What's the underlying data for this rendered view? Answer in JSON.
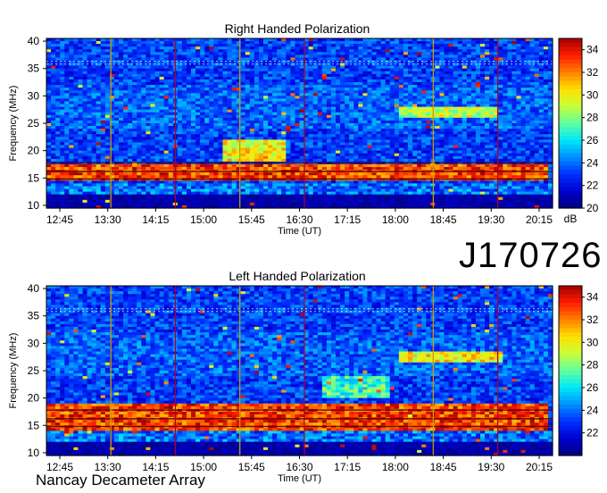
{
  "figure": {
    "id_label": "J170726",
    "footer": "Nancay Decameter Array"
  },
  "colors": {
    "colormap": [
      "#00007f",
      "#0000d0",
      "#0030ff",
      "#0090ff",
      "#00e8f8",
      "#60ffa0",
      "#c8ff38",
      "#ffe000",
      "#ff8000",
      "#ff1c00",
      "#a00000"
    ],
    "marker_lines": [
      "#c89a00",
      "#b00020",
      "#c89a00",
      "#b00020"
    ]
  },
  "chart_data": [
    {
      "type": "heatmap",
      "title": "Right Handed Polarization",
      "xlabel": "Time (UT)",
      "ylabel": "Frequency (MHz)",
      "x_ticks": [
        "12:45",
        "13:30",
        "14:15",
        "15:00",
        "15:45",
        "16:30",
        "17:15",
        "18:00",
        "18:45",
        "19:30",
        "20:15"
      ],
      "x_range_hours": [
        12.5,
        20.35
      ],
      "y_ticks": [
        10,
        15,
        20,
        25,
        30,
        35,
        40
      ],
      "ylim": [
        9.5,
        40.5
      ],
      "colorbar": {
        "label": "dB",
        "range": [
          20,
          35
        ],
        "ticks": [
          20,
          22,
          24,
          26,
          28,
          30,
          32,
          34
        ]
      },
      "vertical_markers_ut": [
        13.5,
        14.5,
        15.5,
        16.5,
        18.5,
        19.5
      ],
      "bright_features": [
        {
          "f_low": 14.5,
          "f_high": 17.5,
          "t_start": 12.5,
          "t_end": 20.3,
          "level_db": 34
        },
        {
          "f_low": 18,
          "f_high": 22,
          "t_start": 15.2,
          "t_end": 16.2,
          "level_db": 31
        },
        {
          "f_low": 26,
          "f_high": 28,
          "t_start": 18.0,
          "t_end": 19.5,
          "level_db": 30
        }
      ]
    },
    {
      "type": "heatmap",
      "title": "Left Handed Polarization",
      "xlabel": "Time (UT)",
      "ylabel": "Frequency (MHz)",
      "x_ticks": [
        "12:45",
        "13:30",
        "14:15",
        "15:00",
        "15:45",
        "16:30",
        "17:15",
        "18:00",
        "18:45",
        "19:30",
        "20:15"
      ],
      "x_range_hours": [
        12.5,
        20.35
      ],
      "y_ticks": [
        10,
        15,
        20,
        25,
        30,
        35,
        40
      ],
      "ylim": [
        9.5,
        40.5
      ],
      "colorbar": {
        "label": "",
        "range": [
          20,
          35
        ],
        "ticks": [
          22,
          24,
          26,
          28,
          30,
          32,
          34
        ]
      },
      "vertical_markers_ut": [
        13.5,
        14.5,
        15.5,
        16.5,
        18.5,
        19.5
      ],
      "bright_features": [
        {
          "f_low": 14.0,
          "f_high": 19.0,
          "t_start": 12.5,
          "t_end": 20.3,
          "level_db": 34
        },
        {
          "f_low": 26.5,
          "f_high": 28.5,
          "t_start": 18.0,
          "t_end": 19.6,
          "level_db": 31
        },
        {
          "f_low": 20,
          "f_high": 24,
          "t_start": 16.8,
          "t_end": 17.8,
          "level_db": 28
        }
      ]
    }
  ]
}
